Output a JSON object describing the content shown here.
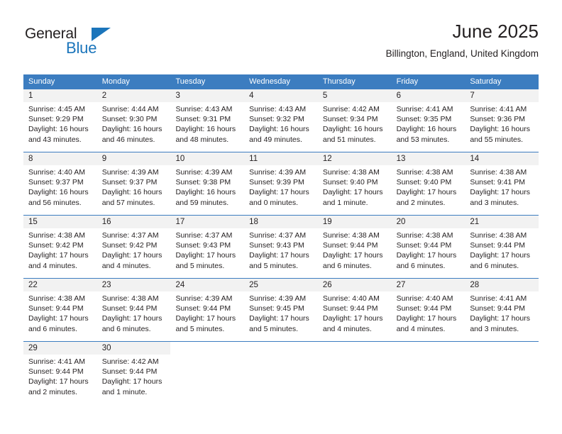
{
  "brand": {
    "name_part1": "General",
    "name_part2": "Blue",
    "triangle_color": "#1b75bb"
  },
  "header": {
    "title": "June 2025",
    "subtitle": "Billington, England, United Kingdom"
  },
  "calendar": {
    "header_color": "#3c7dc0",
    "weekdays": [
      "Sunday",
      "Monday",
      "Tuesday",
      "Wednesday",
      "Thursday",
      "Friday",
      "Saturday"
    ],
    "weeks": [
      [
        {
          "day": "1",
          "sunrise": "Sunrise: 4:45 AM",
          "sunset": "Sunset: 9:29 PM",
          "daylight": "Daylight: 16 hours and 43 minutes."
        },
        {
          "day": "2",
          "sunrise": "Sunrise: 4:44 AM",
          "sunset": "Sunset: 9:30 PM",
          "daylight": "Daylight: 16 hours and 46 minutes."
        },
        {
          "day": "3",
          "sunrise": "Sunrise: 4:43 AM",
          "sunset": "Sunset: 9:31 PM",
          "daylight": "Daylight: 16 hours and 48 minutes."
        },
        {
          "day": "4",
          "sunrise": "Sunrise: 4:43 AM",
          "sunset": "Sunset: 9:32 PM",
          "daylight": "Daylight: 16 hours and 49 minutes."
        },
        {
          "day": "5",
          "sunrise": "Sunrise: 4:42 AM",
          "sunset": "Sunset: 9:34 PM",
          "daylight": "Daylight: 16 hours and 51 minutes."
        },
        {
          "day": "6",
          "sunrise": "Sunrise: 4:41 AM",
          "sunset": "Sunset: 9:35 PM",
          "daylight": "Daylight: 16 hours and 53 minutes."
        },
        {
          "day": "7",
          "sunrise": "Sunrise: 4:41 AM",
          "sunset": "Sunset: 9:36 PM",
          "daylight": "Daylight: 16 hours and 55 minutes."
        }
      ],
      [
        {
          "day": "8",
          "sunrise": "Sunrise: 4:40 AM",
          "sunset": "Sunset: 9:37 PM",
          "daylight": "Daylight: 16 hours and 56 minutes."
        },
        {
          "day": "9",
          "sunrise": "Sunrise: 4:39 AM",
          "sunset": "Sunset: 9:37 PM",
          "daylight": "Daylight: 16 hours and 57 minutes."
        },
        {
          "day": "10",
          "sunrise": "Sunrise: 4:39 AM",
          "sunset": "Sunset: 9:38 PM",
          "daylight": "Daylight: 16 hours and 59 minutes."
        },
        {
          "day": "11",
          "sunrise": "Sunrise: 4:39 AM",
          "sunset": "Sunset: 9:39 PM",
          "daylight": "Daylight: 17 hours and 0 minutes."
        },
        {
          "day": "12",
          "sunrise": "Sunrise: 4:38 AM",
          "sunset": "Sunset: 9:40 PM",
          "daylight": "Daylight: 17 hours and 1 minute."
        },
        {
          "day": "13",
          "sunrise": "Sunrise: 4:38 AM",
          "sunset": "Sunset: 9:40 PM",
          "daylight": "Daylight: 17 hours and 2 minutes."
        },
        {
          "day": "14",
          "sunrise": "Sunrise: 4:38 AM",
          "sunset": "Sunset: 9:41 PM",
          "daylight": "Daylight: 17 hours and 3 minutes."
        }
      ],
      [
        {
          "day": "15",
          "sunrise": "Sunrise: 4:38 AM",
          "sunset": "Sunset: 9:42 PM",
          "daylight": "Daylight: 17 hours and 4 minutes."
        },
        {
          "day": "16",
          "sunrise": "Sunrise: 4:37 AM",
          "sunset": "Sunset: 9:42 PM",
          "daylight": "Daylight: 17 hours and 4 minutes."
        },
        {
          "day": "17",
          "sunrise": "Sunrise: 4:37 AM",
          "sunset": "Sunset: 9:43 PM",
          "daylight": "Daylight: 17 hours and 5 minutes."
        },
        {
          "day": "18",
          "sunrise": "Sunrise: 4:37 AM",
          "sunset": "Sunset: 9:43 PM",
          "daylight": "Daylight: 17 hours and 5 minutes."
        },
        {
          "day": "19",
          "sunrise": "Sunrise: 4:38 AM",
          "sunset": "Sunset: 9:44 PM",
          "daylight": "Daylight: 17 hours and 6 minutes."
        },
        {
          "day": "20",
          "sunrise": "Sunrise: 4:38 AM",
          "sunset": "Sunset: 9:44 PM",
          "daylight": "Daylight: 17 hours and 6 minutes."
        },
        {
          "day": "21",
          "sunrise": "Sunrise: 4:38 AM",
          "sunset": "Sunset: 9:44 PM",
          "daylight": "Daylight: 17 hours and 6 minutes."
        }
      ],
      [
        {
          "day": "22",
          "sunrise": "Sunrise: 4:38 AM",
          "sunset": "Sunset: 9:44 PM",
          "daylight": "Daylight: 17 hours and 6 minutes."
        },
        {
          "day": "23",
          "sunrise": "Sunrise: 4:38 AM",
          "sunset": "Sunset: 9:44 PM",
          "daylight": "Daylight: 17 hours and 6 minutes."
        },
        {
          "day": "24",
          "sunrise": "Sunrise: 4:39 AM",
          "sunset": "Sunset: 9:44 PM",
          "daylight": "Daylight: 17 hours and 5 minutes."
        },
        {
          "day": "25",
          "sunrise": "Sunrise: 4:39 AM",
          "sunset": "Sunset: 9:45 PM",
          "daylight": "Daylight: 17 hours and 5 minutes."
        },
        {
          "day": "26",
          "sunrise": "Sunrise: 4:40 AM",
          "sunset": "Sunset: 9:44 PM",
          "daylight": "Daylight: 17 hours and 4 minutes."
        },
        {
          "day": "27",
          "sunrise": "Sunrise: 4:40 AM",
          "sunset": "Sunset: 9:44 PM",
          "daylight": "Daylight: 17 hours and 4 minutes."
        },
        {
          "day": "28",
          "sunrise": "Sunrise: 4:41 AM",
          "sunset": "Sunset: 9:44 PM",
          "daylight": "Daylight: 17 hours and 3 minutes."
        }
      ],
      [
        {
          "day": "29",
          "sunrise": "Sunrise: 4:41 AM",
          "sunset": "Sunset: 9:44 PM",
          "daylight": "Daylight: 17 hours and 2 minutes."
        },
        {
          "day": "30",
          "sunrise": "Sunrise: 4:42 AM",
          "sunset": "Sunset: 9:44 PM",
          "daylight": "Daylight: 17 hours and 1 minute."
        },
        {
          "day": "",
          "sunrise": "",
          "sunset": "",
          "daylight": ""
        },
        {
          "day": "",
          "sunrise": "",
          "sunset": "",
          "daylight": ""
        },
        {
          "day": "",
          "sunrise": "",
          "sunset": "",
          "daylight": ""
        },
        {
          "day": "",
          "sunrise": "",
          "sunset": "",
          "daylight": ""
        },
        {
          "day": "",
          "sunrise": "",
          "sunset": "",
          "daylight": ""
        }
      ]
    ]
  }
}
